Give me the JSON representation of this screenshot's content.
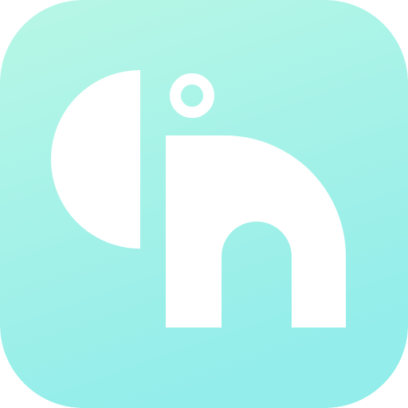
{
  "app_icon": {
    "icon": "cn-logo-icon",
    "colors": {
      "background_top": "#B8F7E6",
      "background_bottom": "#93EDEA",
      "glyph": "#FFFFFF"
    }
  }
}
